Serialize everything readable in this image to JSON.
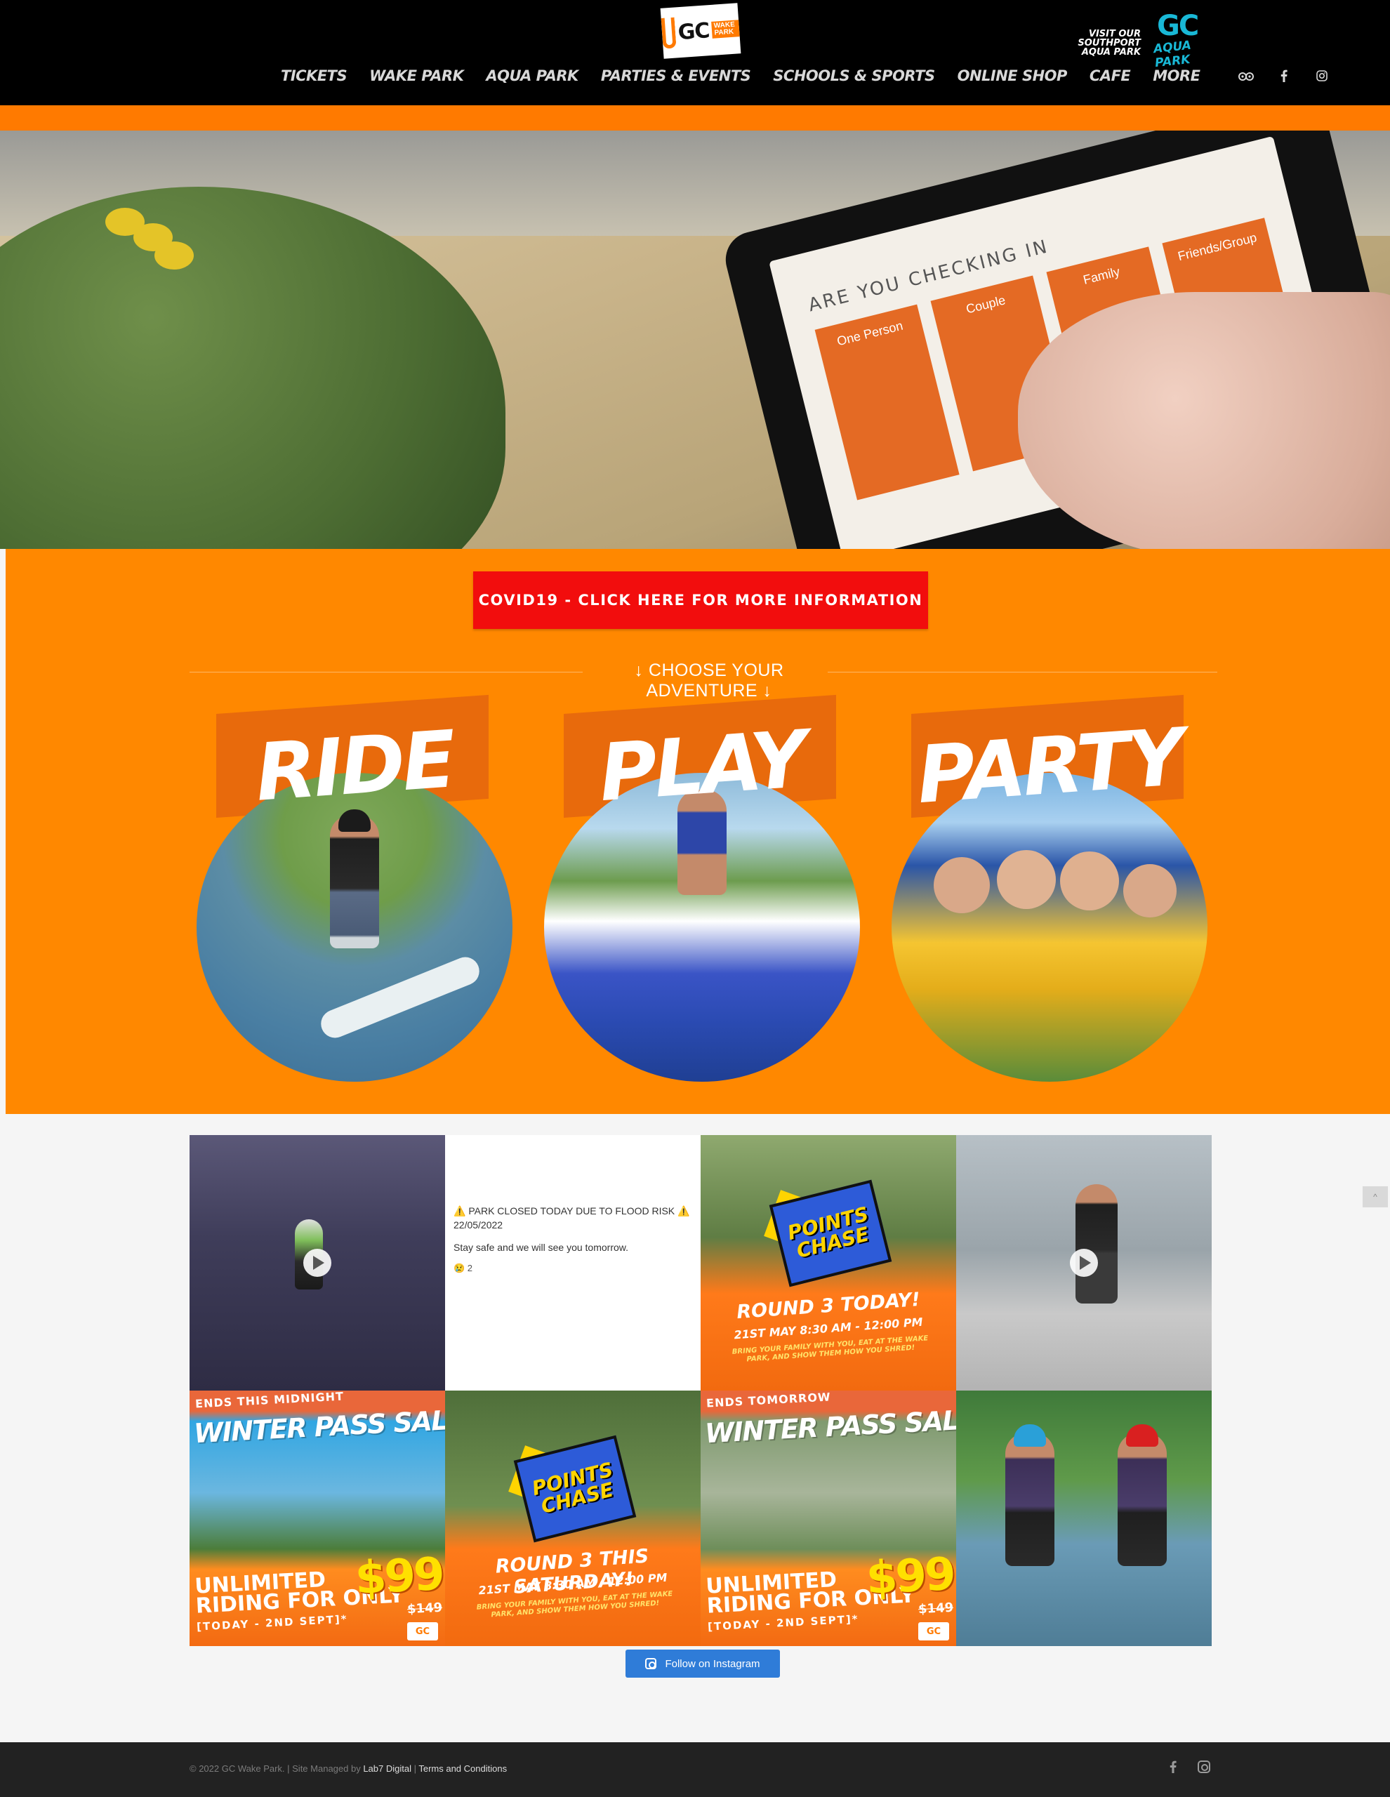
{
  "header": {
    "logo_text": "GC",
    "logo_sub": "WAKE PARK",
    "aqua_promo_text": "VISIT OUR SOUTHPORT AQUA PARK",
    "aqua_logo_gc": "GC",
    "aqua_logo_text": "AQUA PARK",
    "nav": [
      "TICKETS",
      "WAKE PARK",
      "AQUA PARK",
      "PARTIES & EVENTS",
      "SCHOOLS & SPORTS",
      "ONLINE SHOP",
      "CAFE",
      "MORE"
    ],
    "icons": [
      "tripadvisor-icon",
      "facebook-icon",
      "instagram-icon"
    ]
  },
  "hero": {
    "screen_heading": "ARE YOU CHECKING IN",
    "options": [
      "One Person",
      "Couple",
      "Family",
      "Friends/Group"
    ]
  },
  "adventure": {
    "covid_button": "COVID19 - CLICK HERE FOR MORE INFORMATION",
    "choose_label": "↓ CHOOSE YOUR ADVENTURE ↓",
    "cards": [
      "RIDE",
      "PLAY",
      "PARTY"
    ]
  },
  "feed": {
    "flood_notice": "⚠️ PARK CLOSED TODAY DUE TO FLOOD RISK ⚠️ 22/05/2022",
    "flood_body": "Stay safe and we will see you tomorrow.",
    "flood_likes": "😢 2",
    "points_chase": "POINTS CHASE",
    "round3_today": "ROUND 3 TODAY!",
    "round3_saturday": "ROUND 3 THIS SATURDAY!",
    "round3_time": "21ST MAY 8:30 AM - 12:00 PM",
    "round3_small": "BRING YOUR FAMILY WITH YOU, EAT AT THE WAKE PARK, AND SHOW THEM HOW YOU SHRED!",
    "ends_midnight": "ENDS THIS MIDNIGHT",
    "ends_tomorrow": "ENDS TOMORROW",
    "sale_title": "WINTER PASS SALE",
    "unlimited": "UNLIMITED",
    "riding_for_only": "RIDING FOR ONLY",
    "price": "$99",
    "old_price": "$149",
    "dates": "[TODAY - 2ND SEPT]*",
    "mini_logo": "GC",
    "follow_button": "Follow on Instagram"
  },
  "scroll_top": "^",
  "footer": {
    "copyright": "© 2022 GC Wake Park. | Site Managed by ",
    "agency": "Lab7 Digital",
    "separator": " | ",
    "terms": "Terms and Conditions"
  },
  "colors": {
    "brand_orange": "#ff8800",
    "covid_red": "#f20d0d",
    "header_black": "#000000",
    "footer_dark": "#222222",
    "instagram_blue": "#2f7cd8"
  }
}
